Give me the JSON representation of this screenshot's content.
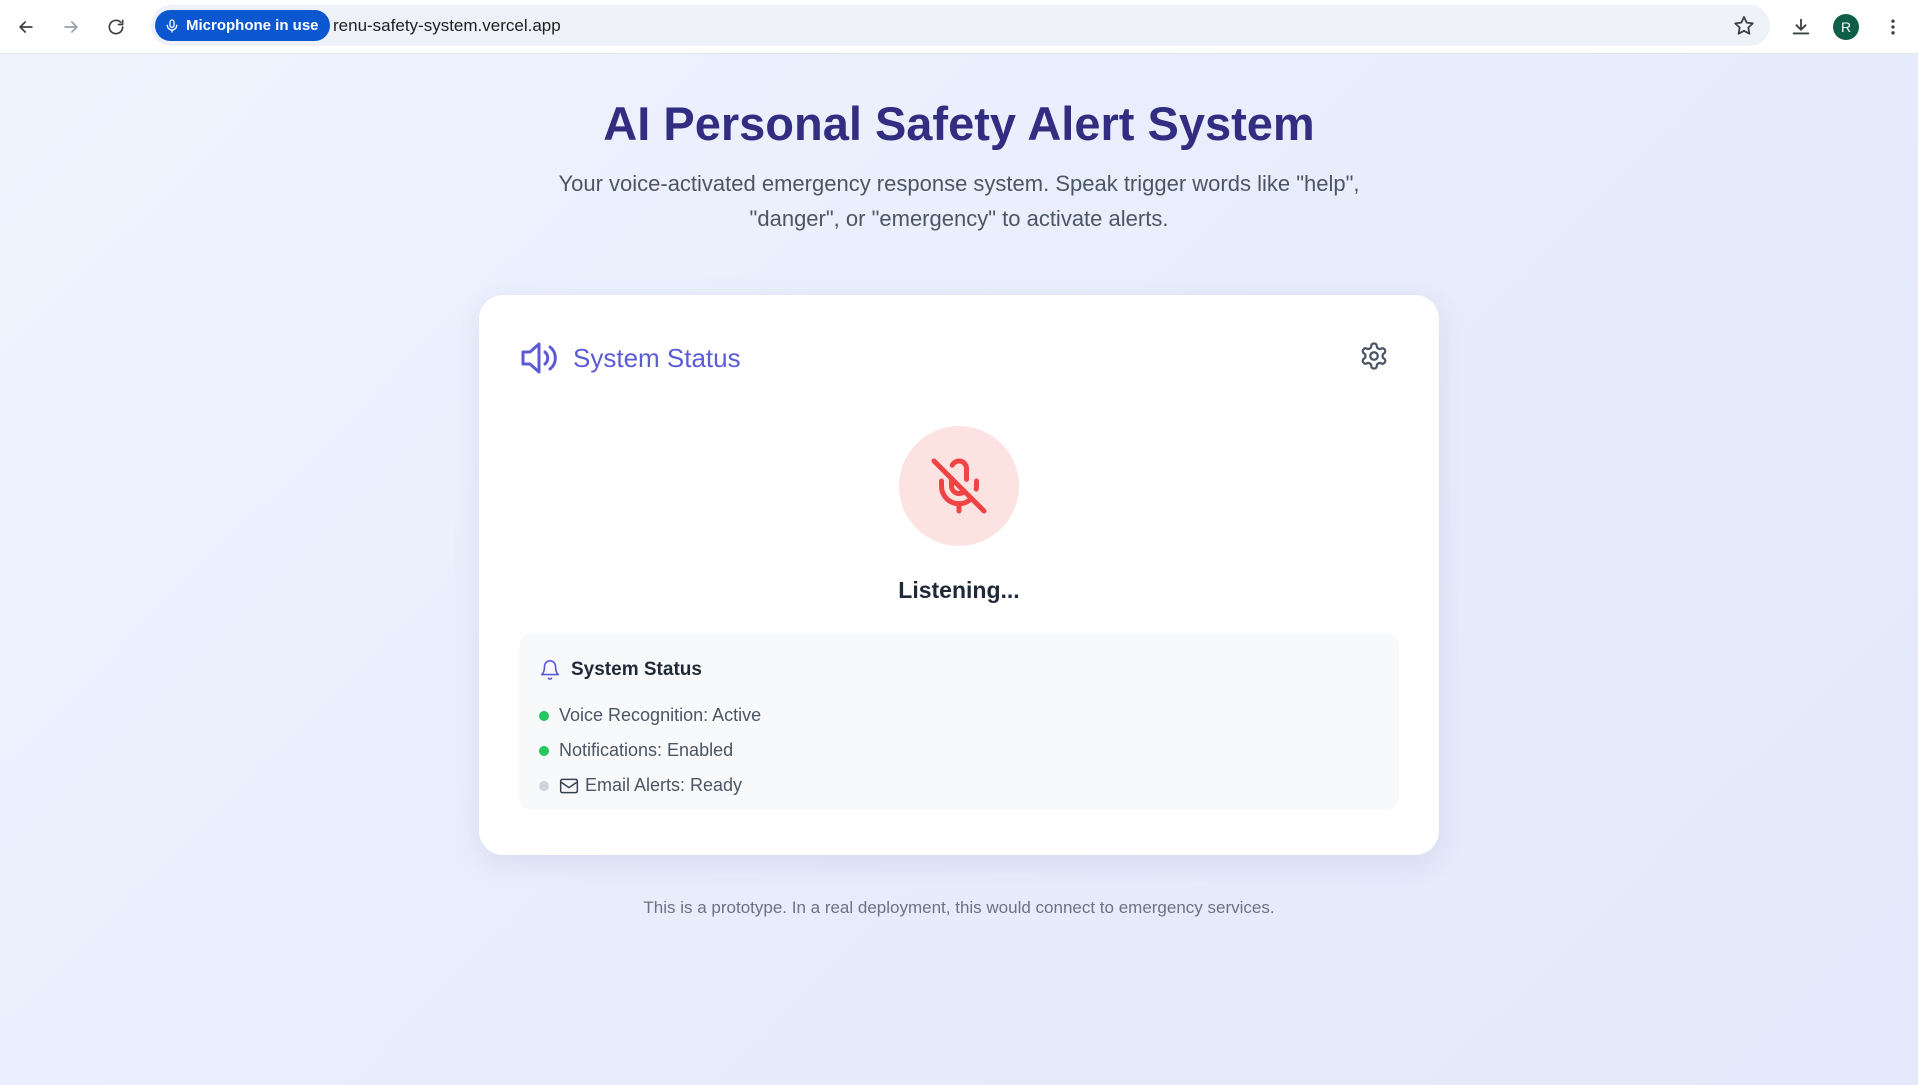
{
  "browser": {
    "mic_chip_label": "Microphone in use",
    "url": "renu-safety-system.vercel.app",
    "profile_initial": "R"
  },
  "header": {
    "title": "AI Personal Safety Alert System",
    "subtitle": "Your voice-activated emergency response system. Speak trigger words like \"help\", \"danger\", or \"emergency\" to activate alerts."
  },
  "card": {
    "title": "System Status",
    "listening_label": "Listening...",
    "status_panel": {
      "title": "System Status",
      "items": [
        {
          "label": "Voice Recognition: Active",
          "state": "active"
        },
        {
          "label": "Notifications: Enabled",
          "state": "active"
        },
        {
          "label": "Email Alerts: Ready",
          "state": "inactive",
          "icon": "mail-icon"
        }
      ]
    }
  },
  "footer": {
    "note": "This is a prototype. In a real deployment, this would connect to emergency services."
  },
  "colors": {
    "accent": "#5b5bd6",
    "title": "#312e81",
    "mic_off": "#ef4444",
    "mic_bg": "#fde2e2",
    "status_active": "#22c55e",
    "status_inactive": "#d1d5db",
    "browser_chip": "#0b57d0"
  }
}
